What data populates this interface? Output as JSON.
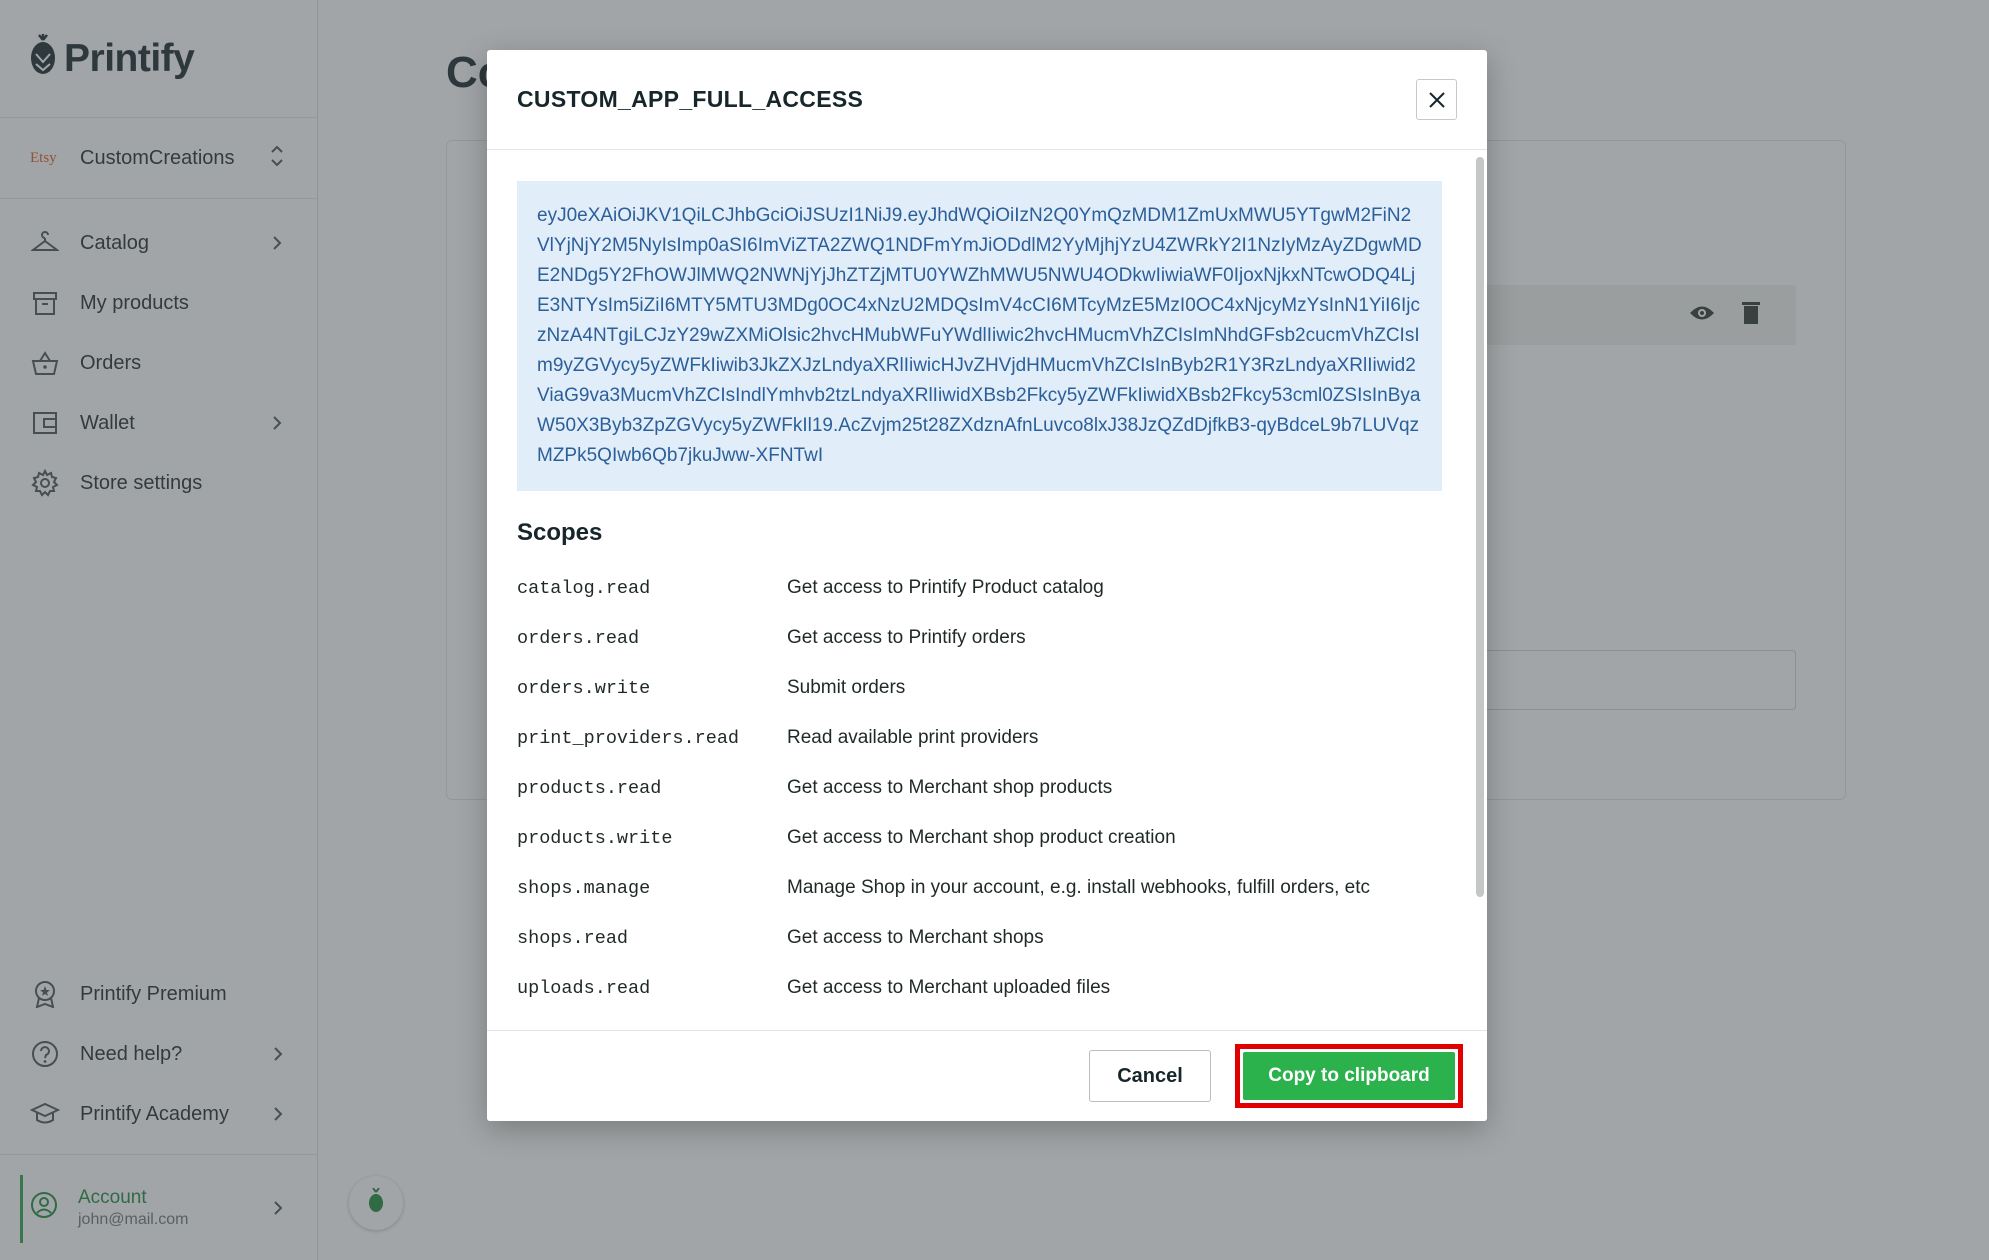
{
  "brand": {
    "name": "Printify"
  },
  "store": {
    "platform": "Etsy",
    "name": "CustomCreations"
  },
  "nav": [
    {
      "label": "Catalog",
      "icon": "hanger-icon",
      "has_chevron": true
    },
    {
      "label": "My products",
      "icon": "box-icon",
      "has_chevron": false
    },
    {
      "label": "Orders",
      "icon": "basket-icon",
      "has_chevron": false
    },
    {
      "label": "Wallet",
      "icon": "wallet-icon",
      "has_chevron": true
    },
    {
      "label": "Store settings",
      "icon": "gear-icon",
      "has_chevron": false
    }
  ],
  "bottom_nav": [
    {
      "label": "Printify Premium",
      "icon": "premium-badge-icon",
      "has_chevron": false
    },
    {
      "label": "Need help?",
      "icon": "help-circle-icon",
      "has_chevron": true
    },
    {
      "label": "Printify Academy",
      "icon": "academy-cap-icon",
      "has_chevron": true
    }
  ],
  "account": {
    "title": "Account",
    "email": "john@mail.com"
  },
  "page": {
    "title": "Co"
  },
  "modal": {
    "title": "CUSTOM_APP_FULL_ACCESS",
    "token": "eyJ0eXAiOiJKV1QiLCJhbGciOiJSUzI1NiJ9.eyJhdWQiOiIzN2Q0YmQzMDM1ZmUxMWU5YTgwM2FiN2VlYjNjY2M5NyIsImp0aSI6ImViZTA2ZWQ1NDFmYmJiODdlM2YyMjhjYzU4ZWRkY2I1NzIyMzAyZDgwMDE2NDg5Y2FhOWJlMWQ2NWNjYjJhZTZjMTU0YWZhMWU5NWU4ODkwIiwiaWF0IjoxNjkxNTcwODQ4LjE3NTYsIm5iZiI6MTY5MTU3MDg0OC4xNzU2MDQsImV4cCI6MTcyMzE5MzI0OC4xNjcyMzYsInN1YiI6IjczNzA4NTgiLCJzY29wZXMiOlsic2hvcHMubWFuYWdlIiwic2hvcHMucmVhZCIsImNhdGFsb2cucmVhZCIsIm9yZGVycy5yZWFkIiwib3JkZXJzLndyaXRlIiwicHJvZHVjdHMucmVhZCIsInByb2R1Y3RzLndyaXRlIiwid2ViaG9va3MucmVhZCIsIndlYmhvb2tzLndyaXRlIiwidXBsb2Fkcy5yZWFkIiwidXBsb2Fkcy53cml0ZSIsInByaW50X3Byb3ZpZGVycy5yZWFkIl19.AcZvjm25t28ZXdznAfnLuvco8lxJ38JzQZdDjfkB3-qyBdceL9b7LUVqzMZPk5QIwb6Qb7jkuJww-XFNTwI",
    "scopes_title": "Scopes",
    "scopes": [
      {
        "name": "catalog.read",
        "desc": "Get access to Printify Product catalog"
      },
      {
        "name": "orders.read",
        "desc": "Get access to Printify orders"
      },
      {
        "name": "orders.write",
        "desc": "Submit orders"
      },
      {
        "name": "print_providers.read",
        "desc": "Read available print providers"
      },
      {
        "name": "products.read",
        "desc": "Get access to Merchant shop products"
      },
      {
        "name": "products.write",
        "desc": "Get access to Merchant shop product creation"
      },
      {
        "name": "shops.manage",
        "desc": "Manage Shop in your account, e.g. install webhooks, fulfill orders, etc"
      },
      {
        "name": "shops.read",
        "desc": "Get access to Merchant shops"
      },
      {
        "name": "uploads.read",
        "desc": "Get access to Merchant uploaded files"
      }
    ],
    "cancel_label": "Cancel",
    "copy_label": "Copy to clipboard"
  },
  "colors": {
    "accent": "#2bb24c",
    "highlight": "#e00000",
    "token_bg": "#e1edf8"
  }
}
